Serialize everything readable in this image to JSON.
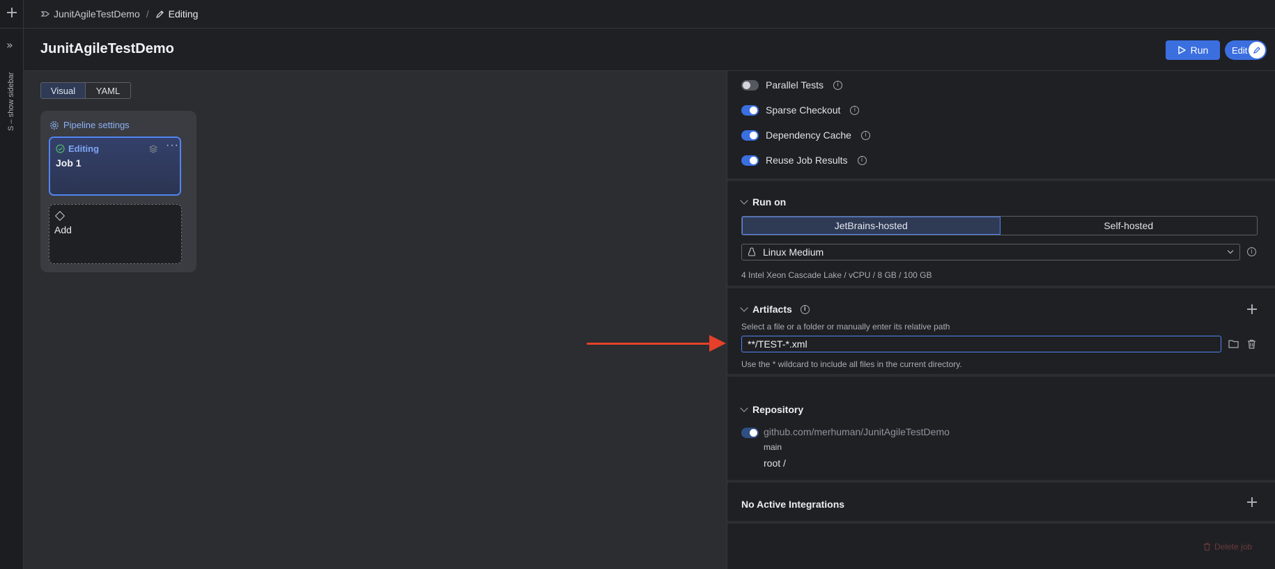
{
  "rail": {
    "show_sidebar_label": "S – show sidebar"
  },
  "breadcrumb": {
    "project": "JunitAgileTestDemo",
    "current": "Editing"
  },
  "header": {
    "title": "JunitAgileTestDemo",
    "run_label": "Run",
    "edit_label": "Edit"
  },
  "canvas": {
    "view_tabs": [
      "Visual",
      "YAML"
    ],
    "pipeline_settings_label": "Pipeline settings",
    "job": {
      "status": "Editing",
      "name": "Job 1"
    },
    "add_label": "Add"
  },
  "panel": {
    "toggles": [
      {
        "label": "Parallel Tests",
        "on": false
      },
      {
        "label": "Sparse Checkout",
        "on": true
      },
      {
        "label": "Dependency Cache",
        "on": true
      },
      {
        "label": "Reuse Job Results",
        "on": true
      }
    ],
    "run_on": {
      "title": "Run on",
      "options": [
        "JetBrains-hosted",
        "Self-hosted"
      ],
      "selected": "JetBrains-hosted",
      "machine": "Linux Medium",
      "machine_spec": "4 Intel Xeon Cascade Lake / vCPU / 8 GB / 100 GB"
    },
    "artifacts": {
      "title": "Artifacts",
      "hint": "Select a file or a folder or manually enter its relative path",
      "path": "**/TEST-*.xml",
      "wildcard_hint": "Use the * wildcard to include all files in the current directory."
    },
    "repository": {
      "title": "Repository",
      "repo": "github.com/merhuman/JunitAgileTestDemo",
      "branch": "main",
      "root": "root /"
    },
    "integrations_title": "No Active Integrations",
    "delete_label": "Delete job"
  },
  "colors": {
    "accent": "#3b6fe0",
    "annotation_arrow": "#e6402a",
    "panel_bg": "#1f2024",
    "canvas_bg": "#2b2d31"
  }
}
